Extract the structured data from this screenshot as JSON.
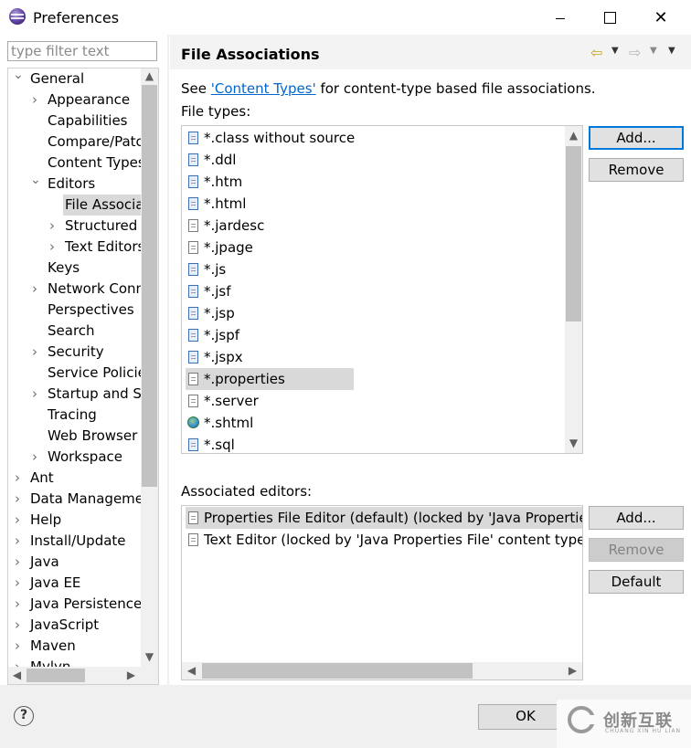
{
  "window": {
    "title": "Preferences",
    "app_icon": "eclipse-icon"
  },
  "filter": {
    "placeholder": "type filter text",
    "value": ""
  },
  "tree": {
    "items": [
      {
        "label": "General",
        "twisty": "expanded"
      },
      {
        "label": "Appearance",
        "twisty": "collapsed"
      },
      {
        "label": "Capabilities",
        "twisty": ""
      },
      {
        "label": "Compare/Patch",
        "twisty": ""
      },
      {
        "label": "Content Types",
        "twisty": ""
      },
      {
        "label": "Editors",
        "twisty": "expanded"
      },
      {
        "label": "File Associations",
        "twisty": "",
        "selected": true
      },
      {
        "label": "Structured Text Editors",
        "twisty": "collapsed"
      },
      {
        "label": "Text Editors",
        "twisty": "collapsed"
      },
      {
        "label": "Keys",
        "twisty": ""
      },
      {
        "label": "Network Connections",
        "twisty": "collapsed"
      },
      {
        "label": "Perspectives",
        "twisty": ""
      },
      {
        "label": "Search",
        "twisty": ""
      },
      {
        "label": "Security",
        "twisty": "collapsed"
      },
      {
        "label": "Service Policies",
        "twisty": ""
      },
      {
        "label": "Startup and Shutdown",
        "twisty": "collapsed"
      },
      {
        "label": "Tracing",
        "twisty": ""
      },
      {
        "label": "Web Browser",
        "twisty": ""
      },
      {
        "label": "Workspace",
        "twisty": "collapsed"
      },
      {
        "label": "Ant",
        "twisty": "collapsed"
      },
      {
        "label": "Data Management",
        "twisty": "collapsed"
      },
      {
        "label": "Help",
        "twisty": "collapsed"
      },
      {
        "label": "Install/Update",
        "twisty": "collapsed"
      },
      {
        "label": "Java",
        "twisty": "collapsed"
      },
      {
        "label": "Java EE",
        "twisty": "collapsed"
      },
      {
        "label": "Java Persistence",
        "twisty": "collapsed"
      },
      {
        "label": "JavaScript",
        "twisty": "collapsed"
      },
      {
        "label": "Maven",
        "twisty": "collapsed"
      },
      {
        "label": "Mylyn",
        "twisty": "collapsed"
      }
    ]
  },
  "page": {
    "title": "File Associations",
    "desc_prefix": "See ",
    "desc_link": "'Content Types'",
    "desc_suffix": " for content-type based file associations.",
    "file_types_label": "File types:",
    "associated_label": "Associated editors:"
  },
  "file_types": [
    {
      "label": "*.class without source",
      "icon": "class-file-icon"
    },
    {
      "label": "*.ddl",
      "icon": "ddl-file-icon"
    },
    {
      "label": "*.htm",
      "icon": "html-file-icon"
    },
    {
      "label": "*.html",
      "icon": "html-file-icon"
    },
    {
      "label": "*.jardesc",
      "icon": "jardesc-file-icon"
    },
    {
      "label": "*.jpage",
      "icon": "jpage-file-icon"
    },
    {
      "label": "*.js",
      "icon": "js-file-icon"
    },
    {
      "label": "*.jsf",
      "icon": "jsf-file-icon"
    },
    {
      "label": "*.jsp",
      "icon": "jsp-file-icon"
    },
    {
      "label": "*.jspf",
      "icon": "jspf-file-icon"
    },
    {
      "label": "*.jspx",
      "icon": "jspx-file-icon"
    },
    {
      "label": "*.properties",
      "icon": "text-file-icon",
      "selected": true
    },
    {
      "label": "*.server",
      "icon": "server-file-icon"
    },
    {
      "label": "*.shtml",
      "icon": "globe-icon"
    },
    {
      "label": "*.sql",
      "icon": "sql-file-icon"
    }
  ],
  "editors": [
    {
      "label": "Properties File Editor (default) (locked by 'Java Properties File' content type)",
      "selected": true
    },
    {
      "label": "Text Editor (locked by 'Java Properties File' content type)"
    }
  ],
  "buttons": {
    "add": "Add...",
    "remove": "Remove",
    "add2": "Add...",
    "remove2": "Remove",
    "default": "Default",
    "ok": "OK",
    "help": "?"
  },
  "watermark": {
    "text": "创新互联",
    "sub": "CHUANG XIN HU LIAN"
  }
}
